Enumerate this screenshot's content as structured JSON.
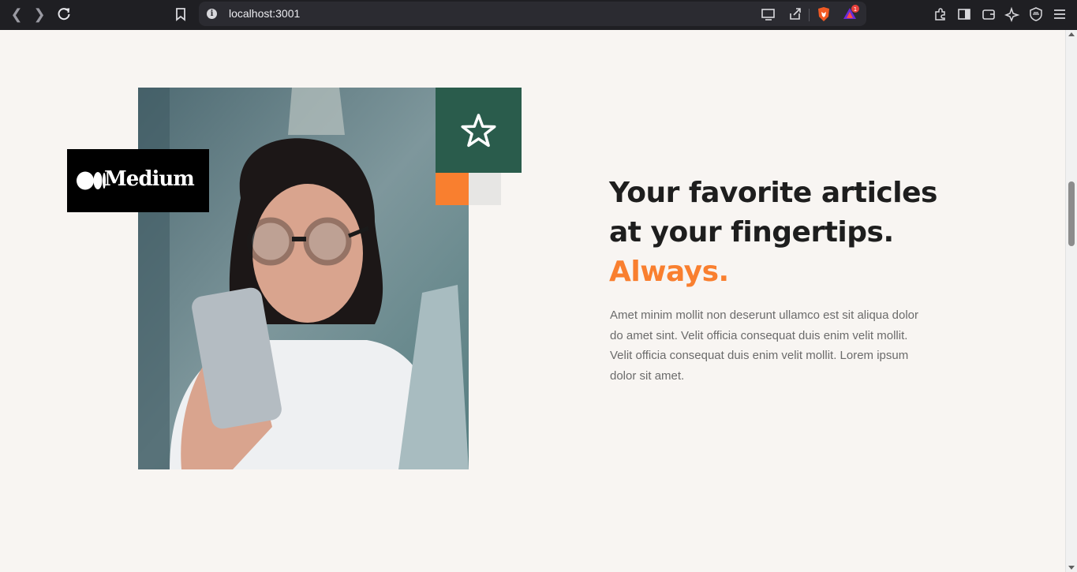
{
  "browser": {
    "url": "localhost:3001",
    "notification_count": "1"
  },
  "hero": {
    "headline_line1": "Your favorite articles",
    "headline_line2": "at your fingertips.",
    "headline_accent": "Always.",
    "body": "Amet minim mollit non deserunt ullamco est sit aliqua dolor do amet sint. Velit officia consequat duis enim velit mollit. Velit officia consequat duis enim velit mollit. Lorem ipsum dolor sit amet.",
    "badge_label": "Medium"
  },
  "colors": {
    "accent": "#f97f2f",
    "green": "#2a5c4c",
    "background": "#f8f5f2"
  }
}
